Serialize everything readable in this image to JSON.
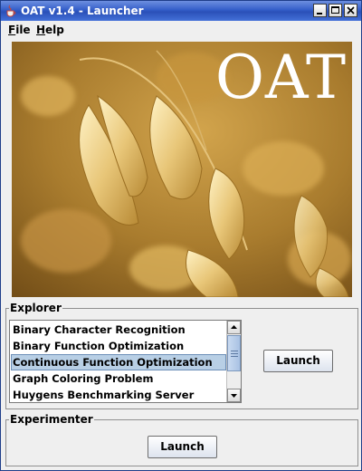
{
  "window": {
    "title": "OAT v1.4 - Launcher"
  },
  "menubar": {
    "items": [
      {
        "mnemonic": "F",
        "rest": "ile"
      },
      {
        "mnemonic": "H",
        "rest": "elp"
      }
    ]
  },
  "banner": {
    "logo_text": "OAT"
  },
  "explorer": {
    "label": "Explorer",
    "items": [
      "Binary Character Recognition",
      "Binary Function Optimization",
      "Continuous Function Optimization",
      "Graph Coloring Problem",
      "Huygens Benchmarking Server"
    ],
    "selected": "Continuous Function Optimization",
    "launch_label": "Launch"
  },
  "experimenter": {
    "label": "Experimenter",
    "launch_label": "Launch"
  },
  "colors": {
    "titlebar": "#2a50b8",
    "selection": "#b8cfe5",
    "scroll_thumb": "#a9c2e4"
  },
  "icons": {
    "app": "java-cup-icon",
    "minimize": "minimize-icon",
    "maximize": "maximize-icon",
    "close": "close-icon",
    "scroll_up": "arrow-up-icon",
    "scroll_down": "arrow-down-icon"
  }
}
